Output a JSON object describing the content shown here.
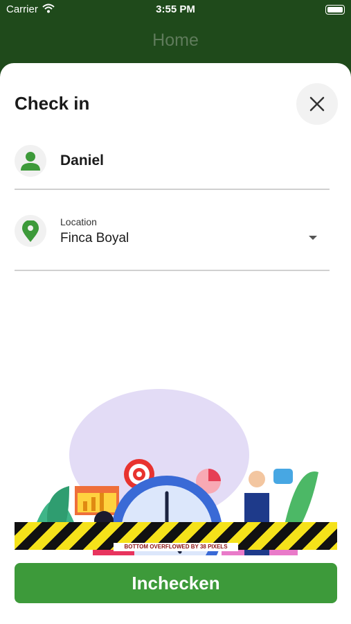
{
  "status_bar": {
    "carrier": "Carrier",
    "time": "3:55 PM"
  },
  "app_bar": {
    "title": "Home"
  },
  "sheet": {
    "title": "Check in",
    "user": {
      "name": "Daniel"
    },
    "location": {
      "label": "Location",
      "value": "Finca Boyal"
    },
    "overflow_warning": "BOTTOM OVERFLOWED BY 38 PIXELS",
    "submit_label": "Inchecken"
  },
  "colors": {
    "primary_green": "#3d9a3a",
    "app_bar_green": "#1f4a1b"
  }
}
